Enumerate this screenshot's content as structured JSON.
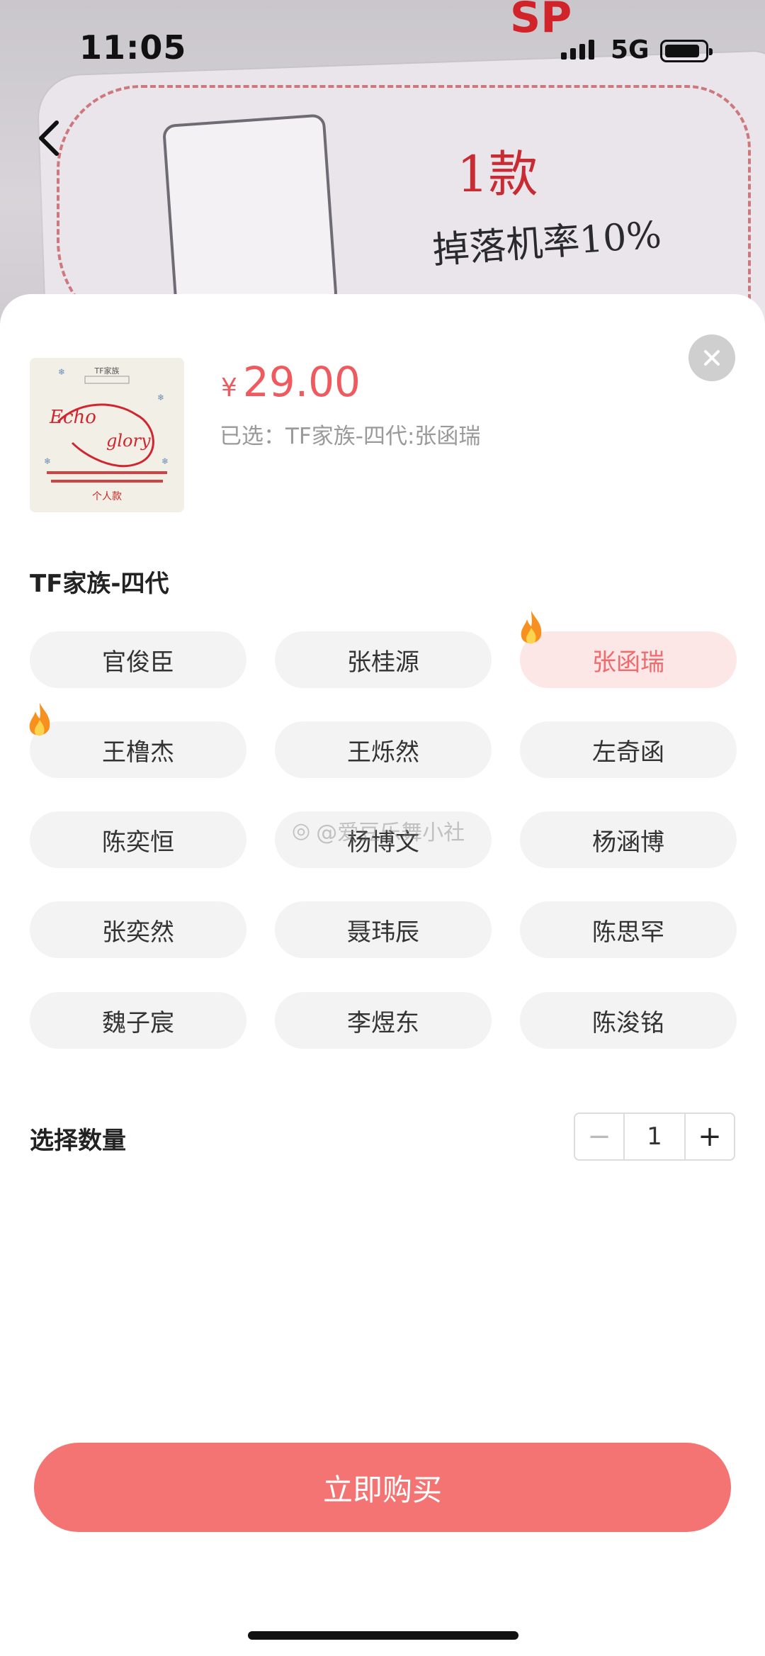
{
  "background": {
    "sp_mark": "SP",
    "caption_line1": "1款",
    "caption_line2": "掉落机率10%"
  },
  "status_bar": {
    "time": "11:05",
    "network": "5G"
  },
  "product": {
    "currency_symbol": "¥",
    "price": "29.00",
    "selected_text": "已选：TF家族-四代:张函瑞",
    "thumb_text": {
      "title_small": "TF家族",
      "line1": "Echo",
      "line2": "glory",
      "caption": "个人款"
    }
  },
  "variant_group": {
    "title": "TF家族-四代",
    "options": [
      {
        "label": "官俊臣",
        "selected": false,
        "hot": false
      },
      {
        "label": "张桂源",
        "selected": false,
        "hot": false
      },
      {
        "label": "张函瑞",
        "selected": true,
        "hot": true
      },
      {
        "label": "王橹杰",
        "selected": false,
        "hot": true
      },
      {
        "label": "王烁然",
        "selected": false,
        "hot": false
      },
      {
        "label": "左奇函",
        "selected": false,
        "hot": false
      },
      {
        "label": "陈奕恒",
        "selected": false,
        "hot": false
      },
      {
        "label": "杨博文",
        "selected": false,
        "hot": false
      },
      {
        "label": "杨涵博",
        "selected": false,
        "hot": false
      },
      {
        "label": "张奕然",
        "selected": false,
        "hot": false
      },
      {
        "label": "聂玮辰",
        "selected": false,
        "hot": false
      },
      {
        "label": "陈思罕",
        "selected": false,
        "hot": false
      },
      {
        "label": "魏子宸",
        "selected": false,
        "hot": false
      },
      {
        "label": "李煜东",
        "selected": false,
        "hot": false
      },
      {
        "label": "陈浚铭",
        "selected": false,
        "hot": false
      }
    ]
  },
  "quantity": {
    "label": "选择数量",
    "minus": "−",
    "value": "1",
    "plus": "+"
  },
  "buy_button": {
    "label": "立即购买"
  },
  "watermark": {
    "text": "@爱豆乐舞小社"
  },
  "colors": {
    "accent": "#ef5a5e",
    "buy_button": "#f47473",
    "selected_bg": "#fde6e6",
    "option_bg": "#f3f3f3"
  }
}
